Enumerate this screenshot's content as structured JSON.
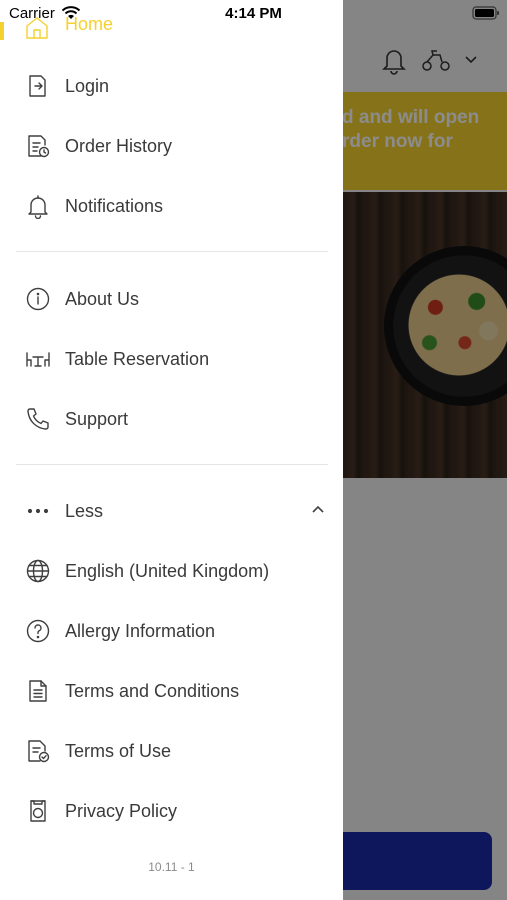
{
  "status_bar": {
    "carrier": "Carrier",
    "time": "4:14 PM"
  },
  "background": {
    "banner_text_line1": "d and will open",
    "banner_text_line2": "rder now for"
  },
  "drawer": {
    "home_label": "Home",
    "items_top": [
      {
        "label": "Login",
        "icon": "login-icon"
      },
      {
        "label": "Order History",
        "icon": "order-history-icon"
      },
      {
        "label": "Notifications",
        "icon": "bell-icon"
      }
    ],
    "items_mid": [
      {
        "label": "About Us",
        "icon": "info-icon"
      },
      {
        "label": "Table Reservation",
        "icon": "table-icon"
      },
      {
        "label": "Support",
        "icon": "phone-icon"
      }
    ],
    "less_label": "Less",
    "items_bottom": [
      {
        "label": "English (United Kingdom)",
        "icon": "globe-icon"
      },
      {
        "label": "Allergy Information",
        "icon": "question-icon"
      },
      {
        "label": "Terms and Conditions",
        "icon": "document-icon"
      },
      {
        "label": "Terms of Use",
        "icon": "document-check-icon"
      },
      {
        "label": "Privacy Policy",
        "icon": "privacy-icon"
      }
    ],
    "version": "10.11 - 1"
  },
  "colors": {
    "accent": "#f4d12e",
    "primary_button": "#1a2ba8"
  }
}
